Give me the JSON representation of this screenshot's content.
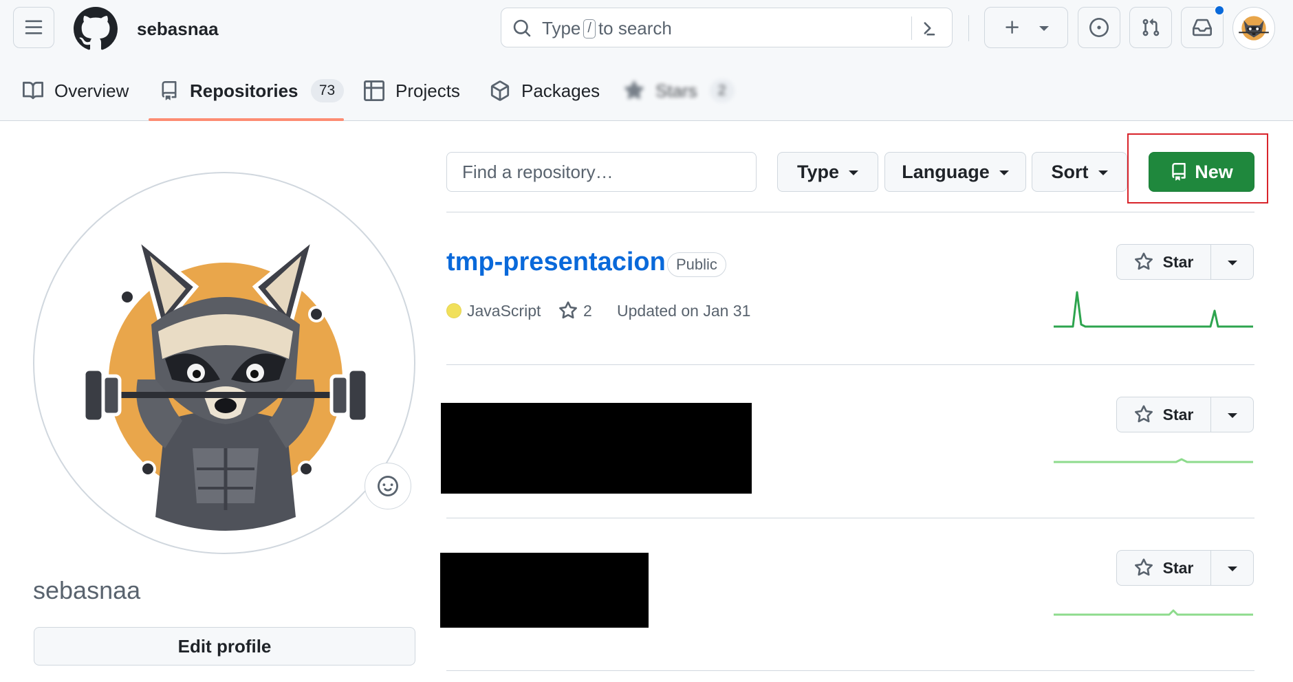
{
  "header": {
    "username": "sebasnaa",
    "search": {
      "prefix": "Type",
      "key": "/",
      "suffix": "to search"
    },
    "colors": {
      "notification_dot": "#0969da"
    }
  },
  "tabs": [
    {
      "label": "Overview",
      "icon": "book-icon"
    },
    {
      "label": "Repositories",
      "icon": "repo-icon",
      "count": "73",
      "selected": true
    },
    {
      "label": "Projects",
      "icon": "table-icon"
    },
    {
      "label": "Packages",
      "icon": "package-icon"
    },
    {
      "label": "Stars",
      "icon": "star-icon",
      "count": "2",
      "blurred": true
    }
  ],
  "profile": {
    "name": "sebasnaa",
    "edit_label": "Edit profile"
  },
  "controls": {
    "find_placeholder": "Find a repository…",
    "type_label": "Type",
    "language_label": "Language",
    "sort_label": "Sort",
    "new_label": "New",
    "colors": {
      "new_button": "#1f883d",
      "highlight_frame": "#d8232a"
    }
  },
  "repos": [
    {
      "name": "tmp-presentacion",
      "visibility": "Public",
      "language": "JavaScript",
      "language_color": "#f1e05a",
      "stars": "2",
      "updated": "Updated on Jan 31",
      "star_label": "Star"
    },
    {
      "redacted": true,
      "star_label": "Star"
    },
    {
      "redacted": true,
      "star_label": "Star"
    }
  ]
}
